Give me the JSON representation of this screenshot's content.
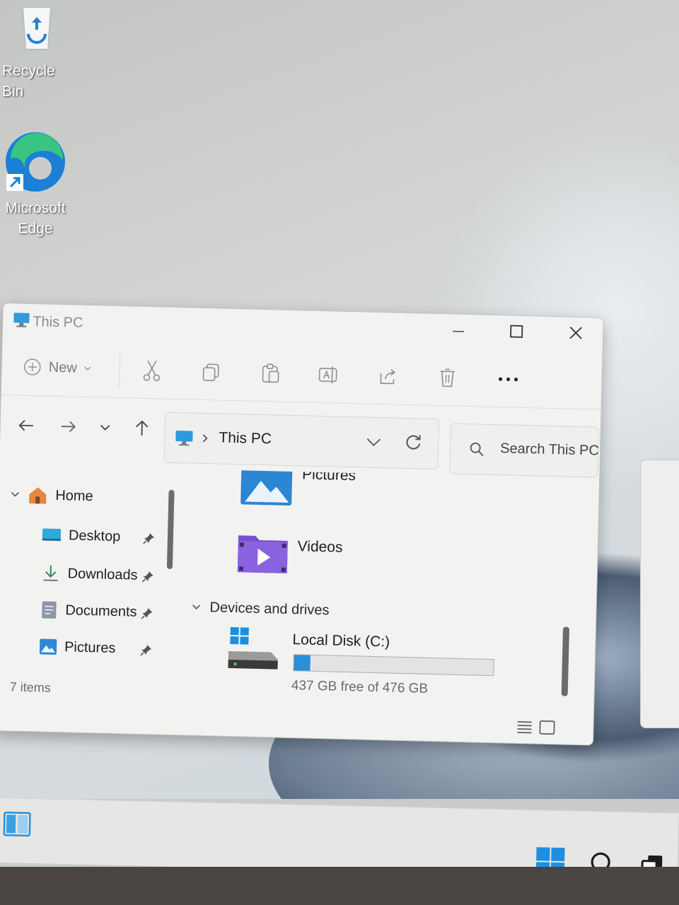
{
  "desktop": {
    "icons": [
      {
        "label": "Recycle Bin",
        "icon": "recycle-bin-icon"
      },
      {
        "label": "Microsoft Edge",
        "icon": "edge-icon"
      }
    ]
  },
  "explorer": {
    "title": "This PC",
    "toolbar": {
      "new_label": "New",
      "actions": [
        "cut-icon",
        "copy-icon",
        "paste-icon",
        "rename-icon",
        "share-icon",
        "delete-icon",
        "more-icon"
      ]
    },
    "address": {
      "location": "This PC"
    },
    "search": {
      "placeholder": "Search This PC"
    },
    "sidebar": {
      "home_label": "Home",
      "items": [
        {
          "label": "Desktop",
          "pinned": true
        },
        {
          "label": "Downloads",
          "pinned": true
        },
        {
          "label": "Documents",
          "pinned": true
        },
        {
          "label": "Pictures",
          "pinned": true
        }
      ]
    },
    "content": {
      "folders": [
        "Pictures",
        "Videos"
      ],
      "group_label": "Devices and drives",
      "drive": {
        "name": "Local Disk (C:)",
        "free_text": "437 GB free of 476 GB",
        "used_fraction": 0.08
      }
    },
    "status": {
      "items_count": "7 items"
    }
  },
  "taskbar": {
    "icons": [
      "snap-layout-icon",
      "start-icon",
      "search-icon",
      "task-view-icon"
    ]
  },
  "colors": {
    "accent": "#2a8fd7",
    "window_bg": "#f2f2f1",
    "taskbar_bg": "#e6e6e4"
  }
}
